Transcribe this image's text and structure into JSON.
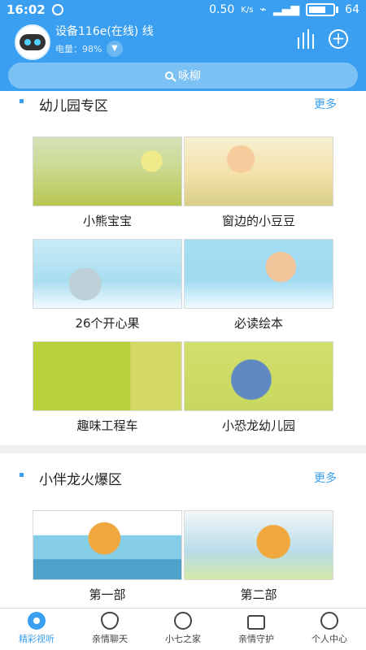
{
  "status_bar": {
    "time": "16:02",
    "network_speed": "0.50",
    "speed_unit": "K/s",
    "battery": "64"
  },
  "header": {
    "device_name": "设备116e(在线) 线",
    "battery_label": "电量：98%",
    "search_placeholder": "咏柳"
  },
  "sections": [
    {
      "title": "幼儿园专区",
      "more": "更多",
      "items": [
        {
          "label": "小熊宝宝"
        },
        {
          "label": "窗边的小豆豆"
        },
        {
          "label": "26个开心果"
        },
        {
          "label": "必读绘本"
        },
        {
          "label": "趣味工程车"
        },
        {
          "label": "小恐龙幼儿园"
        }
      ]
    },
    {
      "title": "小伴龙火爆区",
      "more": "更多",
      "items": [
        {
          "label": "第一部"
        },
        {
          "label": "第二部"
        }
      ]
    }
  ],
  "bottom_nav": [
    {
      "label": "精彩视听",
      "icon": "music-disc-icon",
      "active": true
    },
    {
      "label": "亲情聊天",
      "icon": "heart-chat-icon"
    },
    {
      "label": "小七之家",
      "icon": "fan-home-icon"
    },
    {
      "label": "亲情守护",
      "icon": "message-icon"
    },
    {
      "label": "个人中心",
      "icon": "user-icon"
    }
  ],
  "colors": {
    "accent": "#3a9ff0",
    "background": "#efefef"
  }
}
